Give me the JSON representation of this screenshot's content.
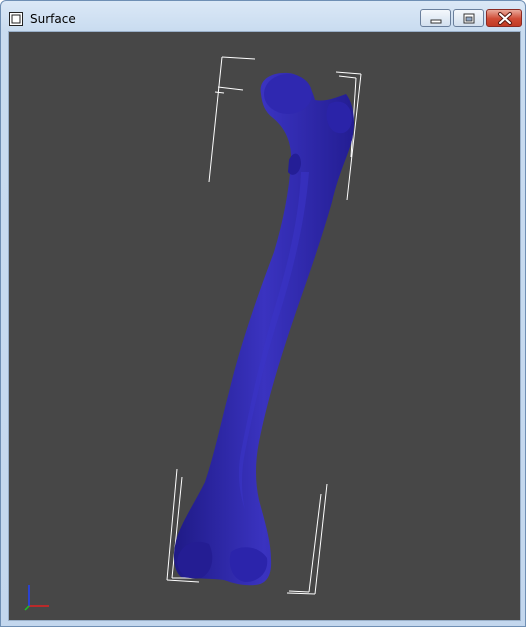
{
  "window": {
    "title": "Surface",
    "buttons": {
      "minimize": "minimize",
      "maximize": "maximize",
      "close": "close"
    }
  },
  "icons": {
    "app": "window-icon",
    "minimize": "minimize-icon",
    "maximize": "maximize-icon",
    "close": "close-icon",
    "axes": "axes-orientation-icon"
  },
  "viewport": {
    "background": "#474747",
    "model_color": "#2d27a6",
    "outline_color": "#ffffff",
    "axis_colors": {
      "x": "#e02020",
      "y": "#20c020",
      "z": "#2040ff"
    }
  }
}
